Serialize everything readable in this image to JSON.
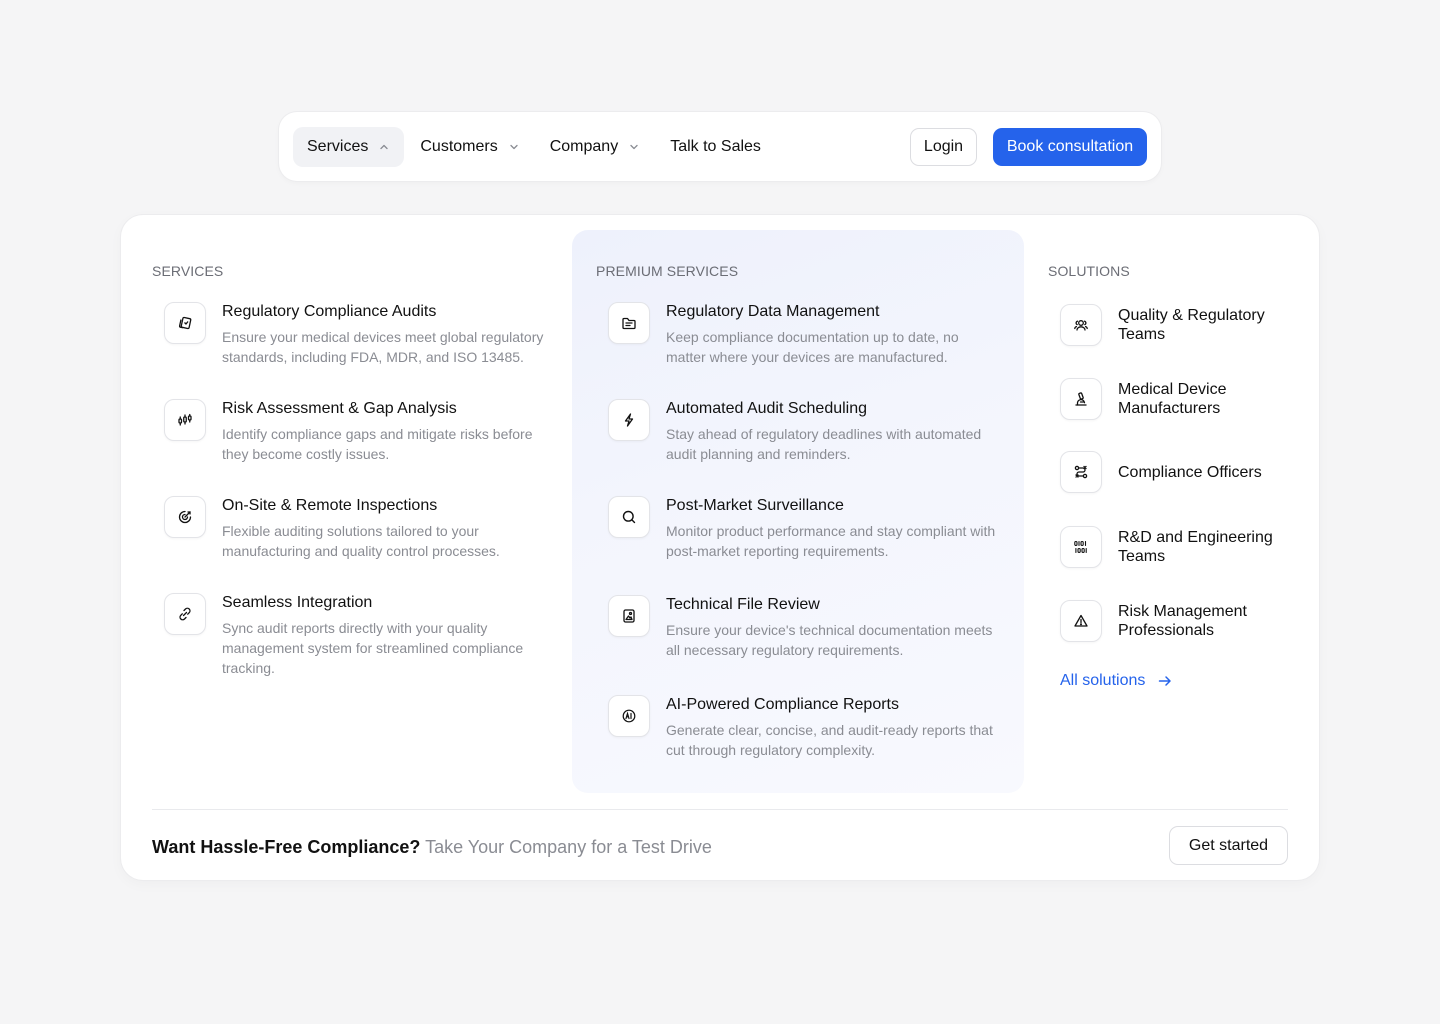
{
  "nav": {
    "items": [
      {
        "label": "Services",
        "has_chevron": true,
        "expanded": true
      },
      {
        "label": "Customers",
        "has_chevron": true,
        "expanded": false
      },
      {
        "label": "Company",
        "has_chevron": true,
        "expanded": false
      },
      {
        "label": "Talk to Sales",
        "has_chevron": false,
        "expanded": false
      }
    ],
    "login_label": "Login",
    "book_label": "Book consultation"
  },
  "services": {
    "title": "SERVICES",
    "items": [
      {
        "title": "Regulatory Compliance Audits",
        "desc": "Ensure your medical devices meet global regulatory standards, including FDA, MDR, and ISO 13485.",
        "icon": "cards-icon"
      },
      {
        "title": "Risk Assessment & Gap Analysis",
        "desc": "Identify compliance gaps and mitigate risks before they become costly issues.",
        "icon": "candlestick-chart-icon"
      },
      {
        "title": "On-Site & Remote Inspections",
        "desc": "Flexible auditing solutions tailored to your manufacturing and quality control processes.",
        "icon": "target-icon"
      },
      {
        "title": "Seamless Integration",
        "desc": "Sync audit reports directly with your quality management system for streamlined compliance tracking.",
        "icon": "link-icon"
      }
    ]
  },
  "premium": {
    "title": "PREMIUM SERVICES",
    "items": [
      {
        "title": "Regulatory Data Management",
        "desc": "Keep compliance documentation up to date, no matter where your devices are manufactured.",
        "icon": "folder-icon"
      },
      {
        "title": "Automated Audit Scheduling",
        "desc": "Stay ahead of regulatory deadlines with automated audit planning and reminders.",
        "icon": "lightning-icon"
      },
      {
        "title": "Post-Market Surveillance",
        "desc": "Monitor product performance and stay compliant with post-market reporting requirements.",
        "icon": "search-icon"
      },
      {
        "title": "Technical File Review",
        "desc": "Ensure your device's technical documentation meets all necessary regulatory requirements.",
        "icon": "file-image-icon"
      },
      {
        "title": "AI-Powered Compliance Reports",
        "desc": "Generate clear, concise, and audit-ready reports that cut through regulatory complexity.",
        "icon": "ai-chip-icon"
      }
    ]
  },
  "solutions": {
    "title": "SOLUTIONS",
    "items": [
      {
        "label_1": "Quality & Regulatory",
        "label_2": "Teams",
        "icon": "users-icon"
      },
      {
        "label_1": "Medical Device",
        "label_2": "Manufacturers",
        "icon": "microscope-icon"
      },
      {
        "label_1": "Compliance Officers",
        "label_2": "",
        "icon": "route-icon"
      },
      {
        "label_1": "R&D and Engineering",
        "label_2": "Teams",
        "icon": "binary-icon"
      },
      {
        "label_1": "Risk Management",
        "label_2": "Professionals",
        "icon": "warning-icon"
      }
    ],
    "all_label": "All solutions"
  },
  "footer": {
    "cta_strong": "Want Hassle-Free Compliance?",
    "cta_muted": "Take Your Company for a Test Drive",
    "button_label": "Get started"
  },
  "colors": {
    "accent": "#2563eb",
    "premium_bg": "#eef1fc",
    "muted_text": "#8a8c93"
  }
}
